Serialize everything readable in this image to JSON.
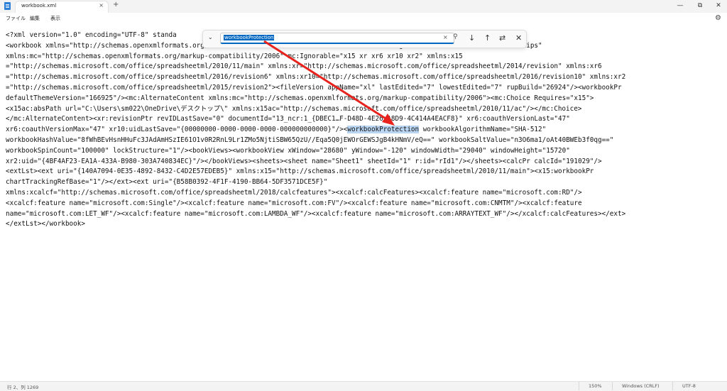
{
  "tab": {
    "title": "workbook.xml",
    "close_icon": "×",
    "new_tab": "+"
  },
  "window": {
    "minimize": "—",
    "maximize": "⧉",
    "close": "✕"
  },
  "menu": {
    "file": "ファイル",
    "edit": "編集",
    "view": "表示",
    "settings_icon": "⚙"
  },
  "find": {
    "value": "workbookProtection",
    "toggle_icon": "⌄",
    "clear_icon": "×",
    "search_icon": "⚲",
    "next_icon": "↓",
    "prev_icon": "↑",
    "replace_icon": "⇄",
    "close_icon": "✕"
  },
  "editor": {
    "lines": [
      "<?xml version=\"1.0\" encoding=\"UTF-8\" standa",
      "<workbook xmlns=\"http://schemas.openxmlformats.org/...                                           org/officeDocument/2006/relationships\"",
      "xmlns:mc=\"http://schemas.openxmlformats.org/markup-compatibility/2006\" mc:Ignorable=\"x15 xr xr6 xr10 xr2\" xmlns:x15",
      "=\"http://schemas.microsoft.com/office/spreadsheetml/2010/11/main\" xmlns:xr=\"http://schemas.microsoft.com/office/spreadsheetml/2014/revision\" xmlns:xr6",
      "=\"http://schemas.microsoft.com/office/spreadsheetml/2016/revision6\" xmlns:xr10=\"http://schemas.microsoft.com/office/spreadsheetml/2016/revision10\" xmlns:xr2",
      "=\"http://schemas.microsoft.com/office/spreadsheetml/2015/revision2\"><fileVersion appName=\"xl\" lastEdited=\"7\" lowestEdited=\"7\" rupBuild=\"26924\"/><workbookPr",
      "defaultThemeVersion=\"166925\"/><mc:AlternateContent xmlns:mc=\"http://schemas.openxmlformats.org/markup-compatibility/2006\"><mc:Choice Requires=\"x15\">",
      "<x15ac:absPath url=\"C:\\Users\\sm022\\OneDrive\\デスクトップ\\\" xmlns:x15ac=\"http://schemas.microsoft.com/office/spreadsheetml/2010/11/ac\"/></mc:Choice>",
      "</mc:AlternateContent><xr:revisionPtr revIDLastSave=\"0\" documentId=\"13_ncr:1_{DBEC1…F-D48D-4E26-A8D9-4C414A4EACF8}\" xr6:coauthVersionLast=\"47\"",
      "xr6:coauthVersionMax=\"47\" xr10:uidLastSave=\"{00000000-0000-0000-0000-000000000000}\"/><",
      "workbookHashValue=\"8fWhBEvHsnHHuFc3JAdAmHSzIE61O1v0R2RnL9Lr1ZMo5NjtiSBW65QzU//Eqa5Q0jEWOrGEWSJgB4kHNmV/eQ==\" workbookSaltValue=\"n3O6ma1/oAt40BWEb3f0qg==\"",
      "workbookSpinCount=\"100000\" lockStructure=\"1\"/><bookViews><workbookView xWindow=\"28680\" yWindow=\"-120\" windowWidth=\"29040\" windowHeight=\"15720\"",
      "xr2:uid=\"{4BF4AF23-EA1A-433A-B980-303A740834EC}\"/></bookViews><sheets><sheet name=\"Sheet1\" sheetId=\"1\" r:id=\"rId1\"/></sheets><calcPr calcId=\"191029\"/>",
      "<extLst><ext uri=\"{140A7094-0E35-4892-8432-C4D2E57EDEB5}\" xmlns:x15=\"http://schemas.microsoft.com/office/spreadsheetml/2010/11/main\"><x15:workbookPr",
      "chartTrackingRefBase=\"1\"/></ext><ext uri=\"{B58B0392-4F1F-4190-BB64-5DF3571DCE5F}\"",
      "xmlns:xcalcf=\"http://schemas.microsoft.com/office/spreadsheetml/2018/calcfeatures\"><xcalcf:calcFeatures><xcalcf:feature name=\"microsoft.com:RD\"/>",
      "<xcalcf:feature name=\"microsoft.com:Single\"/><xcalcf:feature name=\"microsoft.com:FV\"/><xcalcf:feature name=\"microsoft.com:CNMTM\"/><xcalcf:feature",
      "name=\"microsoft.com:LET_WF\"/><xcalcf:feature name=\"microsoft.com:LAMBDA_WF\"/><xcalcf:feature name=\"microsoft.com:ARRAYTEXT_WF\"/></xcalcf:calcFeatures></ext>",
      "</extLst></workbook>"
    ],
    "highlight": "workbookProtection",
    "line10_tail": " workbookAlgorithmName=\"SHA-512\""
  },
  "status": {
    "position": "行 2、列 1269",
    "zoom": "150%",
    "eol": "Windows (CRLF)",
    "encoding": "UTF-8"
  },
  "colors": {
    "accent": "#0067c0",
    "highlight": "#b9d5f2",
    "arrow": "#e8231e"
  }
}
